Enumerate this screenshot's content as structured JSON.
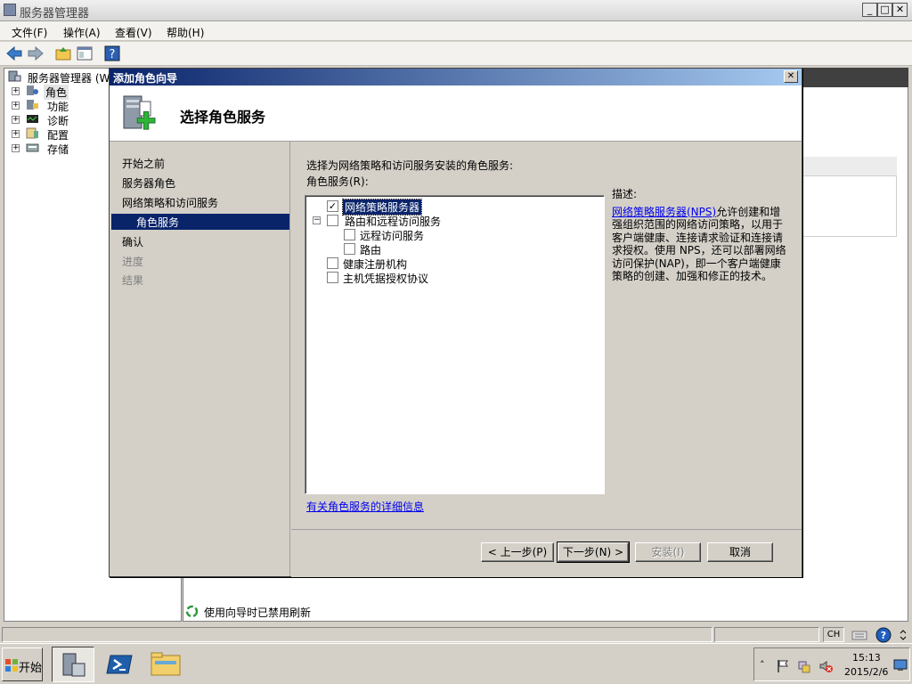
{
  "main_window": {
    "title": "服务器管理器",
    "menu": [
      "文件(F)",
      "操作(A)",
      "查看(V)",
      "帮助(H)"
    ]
  },
  "tree": {
    "root": "服务器管理器 (WI",
    "items": [
      "角色",
      "功能",
      "诊断",
      "配置",
      "存储"
    ]
  },
  "status_text": "使用向导时已禁用刷新",
  "dialog": {
    "title": "添加角色向导",
    "heading": "选择角色服务",
    "steps": [
      {
        "label": "开始之前",
        "state": "normal"
      },
      {
        "label": "服务器角色",
        "state": "normal"
      },
      {
        "label": "网络策略和访问服务",
        "state": "normal"
      },
      {
        "label": "角色服务",
        "state": "active"
      },
      {
        "label": "确认",
        "state": "normal"
      },
      {
        "label": "进度",
        "state": "disabled"
      },
      {
        "label": "结果",
        "state": "disabled"
      }
    ],
    "instruction": "选择为网络策略和访问服务安装的角色服务:",
    "list_label": "角色服务(R):",
    "services": [
      {
        "label": "网络策略服务器",
        "checked": true,
        "level": 0
      },
      {
        "label": "路由和远程访问服务",
        "checked": false,
        "level": 0
      },
      {
        "label": "远程访问服务",
        "checked": false,
        "level": 1
      },
      {
        "label": "路由",
        "checked": false,
        "level": 1
      },
      {
        "label": "健康注册机构",
        "checked": false,
        "level": 0
      },
      {
        "label": "主机凭据授权协议",
        "checked": false,
        "level": 0
      }
    ],
    "description_label": "描述:",
    "description_link": "网络策略服务器(NPS)",
    "description_text": "允许创建和增强组织范围的网络访问策略，以用于客户端健康、连接请求验证和连接请求授权。使用 NPS，还可以部署网络访问保护(NAP)，即一个客户端健康策略的创建、加强和修正的技术。",
    "more_info_link": "有关角色服务的详细信息",
    "buttons": {
      "back": "< 上一步(P)",
      "next": "下一步(N) >",
      "install": "安装(I)",
      "cancel": "取消"
    }
  },
  "statusbar": {
    "lang": "CH"
  },
  "taskbar": {
    "start_label": "开始",
    "clock_time": "15:13",
    "clock_date": "2015/2/6"
  }
}
